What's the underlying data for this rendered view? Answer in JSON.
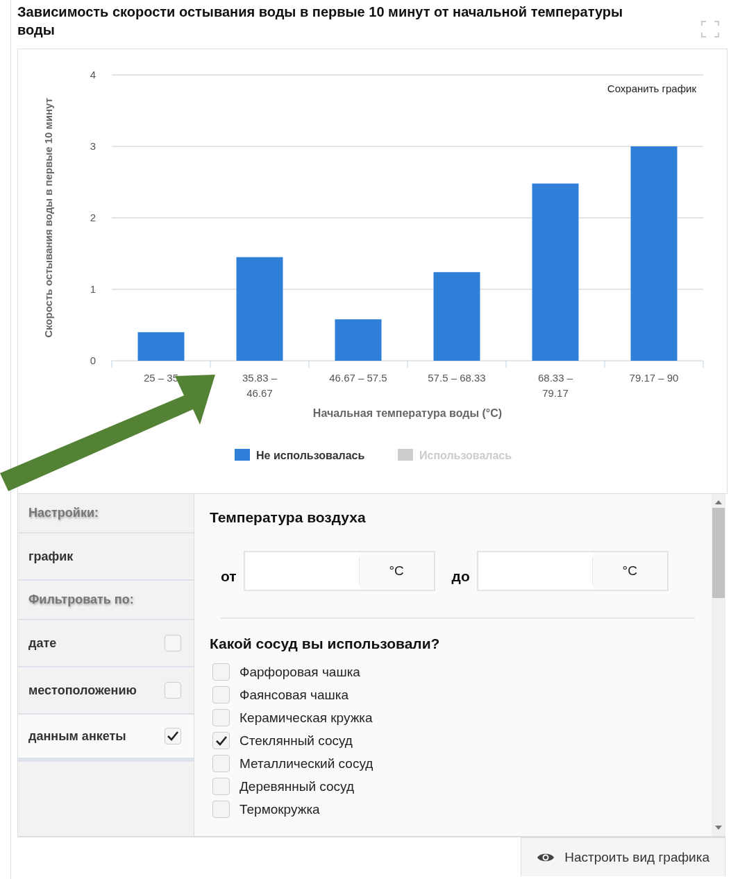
{
  "title": "Зависимость скорости остывания воды в первые 10 минут от начальной температуры воды",
  "chart": {
    "save_label": "Сохранить график",
    "chart_data": {
      "type": "bar",
      "xlabel": "Начальная температура воды (°C)",
      "ylabel": "Скорость остывания воды в первые 10 минут",
      "categories": [
        "25 – 35",
        "35.83 – 46.67",
        "46.67 – 57.5",
        "57.5 – 68.33",
        "68.33 – 79.17",
        "79.17 – 90"
      ],
      "ylim": [
        0,
        4
      ],
      "yticks": [
        0,
        1,
        2,
        3,
        4
      ],
      "grid": true,
      "series": [
        {
          "name": "Не использовалась",
          "color": "#2f7ed8",
          "values": [
            0.4,
            1.45,
            0.58,
            1.24,
            2.48,
            3
          ]
        },
        {
          "name": "Использовалась",
          "values": [
            null,
            null,
            null,
            null,
            null,
            null
          ]
        }
      ]
    },
    "legend": [
      {
        "hidden": false
      },
      {
        "hidden": true
      }
    ]
  },
  "sidebar": {
    "items": [
      {
        "kind": "header",
        "label": "Настройки:"
      },
      {
        "kind": "item",
        "label": "график",
        "selected": false
      },
      {
        "kind": "header",
        "label": "Фильтровать по:"
      },
      {
        "kind": "filter",
        "label": "дате",
        "checked": false,
        "selected": false
      },
      {
        "kind": "filter",
        "label": "местоположению",
        "checked": false,
        "selected": false
      },
      {
        "kind": "filter",
        "label": "данным анкеты",
        "checked": true,
        "selected": true
      }
    ]
  },
  "air_temperature": {
    "heading": "Температура воздуха",
    "from": {
      "label": "от",
      "unit": "°C"
    },
    "to": {
      "label": "до",
      "unit": "°C"
    }
  },
  "vessel": {
    "heading": "Какой сосуд вы использовали?",
    "options": [
      {
        "label": "Фарфоровая чашка",
        "checked": false
      },
      {
        "label": "Фаянсовая чашка",
        "checked": false
      },
      {
        "label": "Керамическая кружка",
        "checked": false
      },
      {
        "label": "Стеклянный сосуд",
        "checked": true
      },
      {
        "label": "Металлический сосуд",
        "checked": false
      },
      {
        "label": "Деревянный сосуд",
        "checked": false
      },
      {
        "label": "Термокружка",
        "checked": false
      }
    ]
  },
  "configure_button": "Настроить вид графика"
}
